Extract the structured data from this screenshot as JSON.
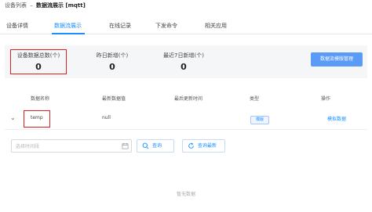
{
  "breadcrumb": {
    "parent": "设备列表",
    "separator": "–",
    "current": "数据流展示 [mqtt]"
  },
  "tabs": [
    {
      "label": "设备详情",
      "active": false
    },
    {
      "label": "数据流展示",
      "active": true
    },
    {
      "label": "在线记录",
      "active": false
    },
    {
      "label": "下发命令",
      "active": false
    },
    {
      "label": "相关应用",
      "active": false
    }
  ],
  "stats": [
    {
      "label": "设备数据总数(个)",
      "value": "0"
    },
    {
      "label": "昨日新增(个)",
      "value": "0"
    },
    {
      "label": "最近7日新增(个)",
      "value": "0"
    }
  ],
  "template_button_label": "数据流模版管理",
  "table": {
    "columns": [
      "数据名称",
      "最新数据值",
      "最后更新时间",
      "类型",
      "操作"
    ],
    "rows": [
      {
        "name": "temp",
        "latest_value": "null",
        "updated_at": "",
        "type": "模版",
        "action": "模拟数据"
      }
    ]
  },
  "filter": {
    "date_placeholder": "选择时间段",
    "query_label": "查询",
    "refresh_label": "查询最新"
  },
  "empty_text": "暂无数据",
  "colors": {
    "accent": "#1890ff",
    "primary_button": "#5b9bf8",
    "highlight_border": "#e02020",
    "stats_background": "#f5f6f8"
  },
  "icons": {
    "calendar": "calendar-icon",
    "search": "search-icon",
    "refresh": "refresh-icon",
    "expand": "chevron-down-icon"
  }
}
